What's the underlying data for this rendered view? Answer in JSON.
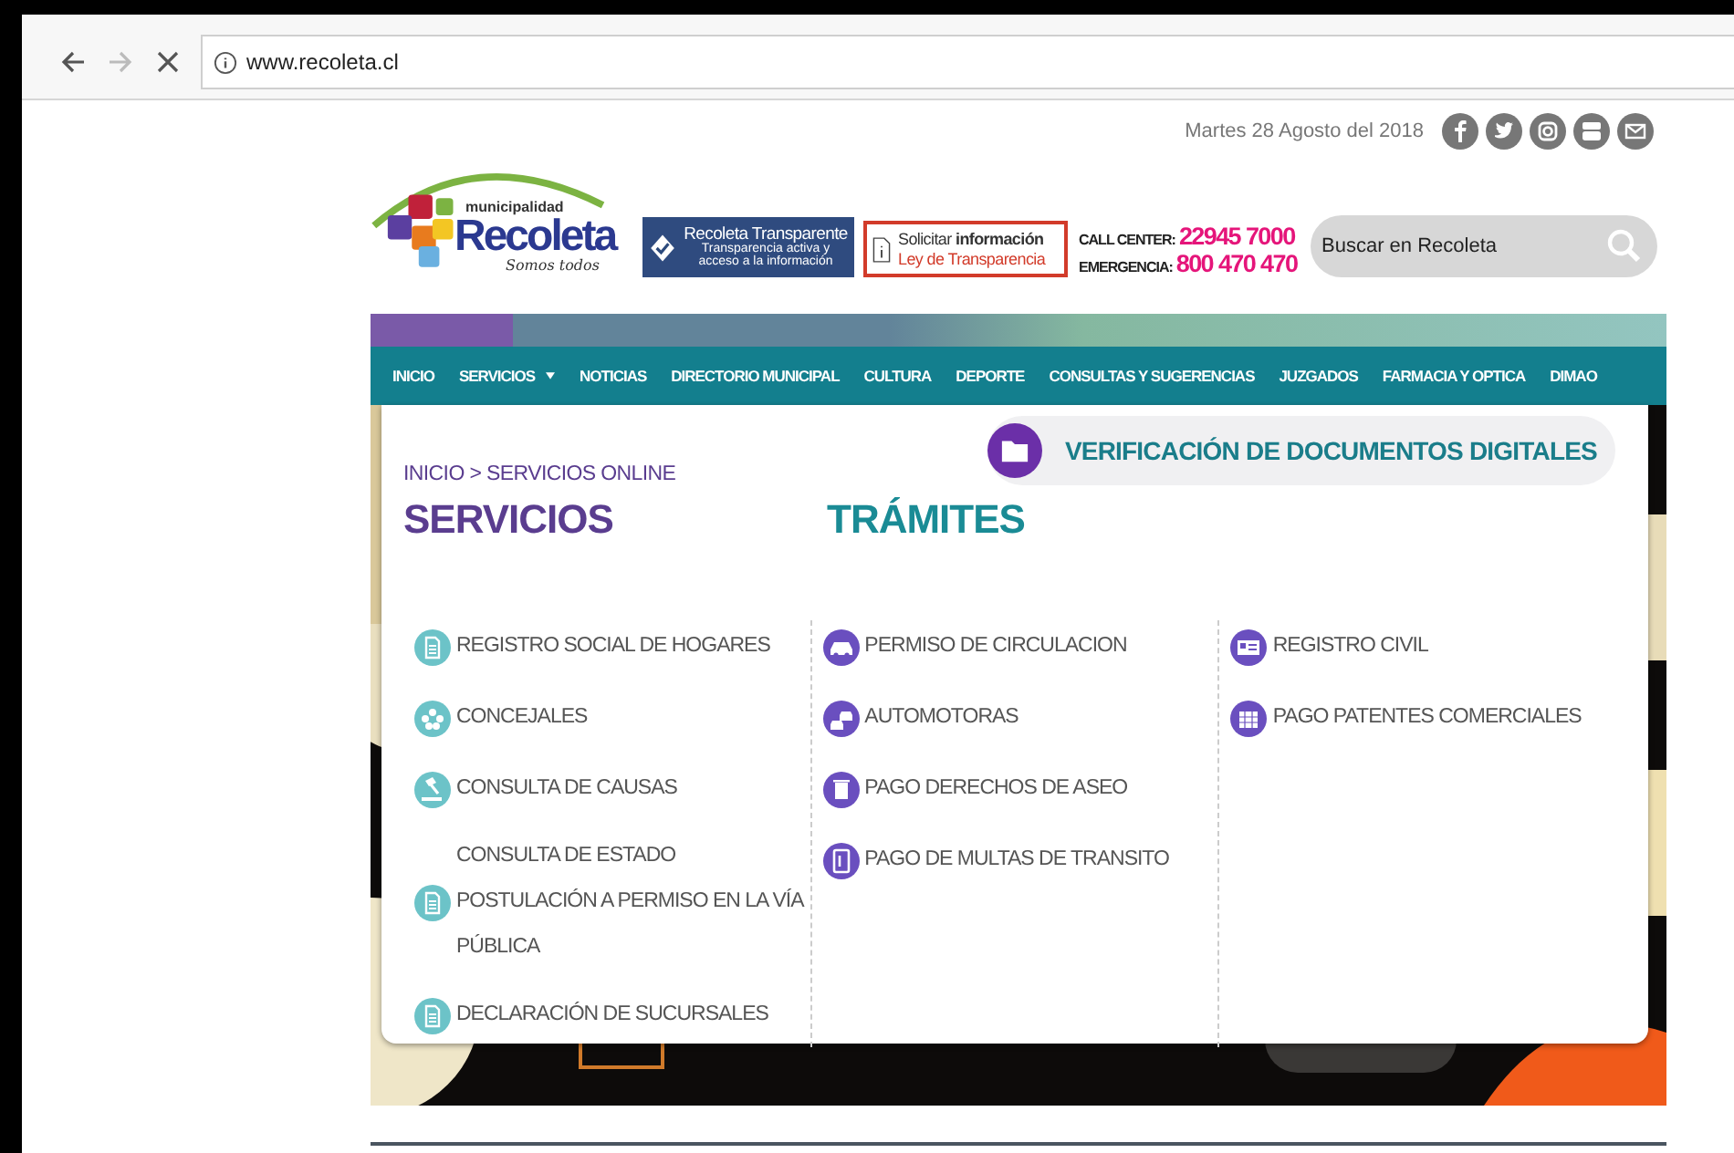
{
  "browser": {
    "url": "www.recoleta.cl"
  },
  "header": {
    "logo": {
      "top": "municipalidad",
      "name": "Recoleta",
      "tagline": "Somos todos"
    },
    "date": "Martes 28 Agosto del 2018",
    "transparency": {
      "title": "Recoleta Transparente",
      "subtitle": "Transparencia activa y acceso a la información"
    },
    "request": {
      "line1_plain": "Solicitar ",
      "line1_bold": "información",
      "line2": "Ley de Transparencia"
    },
    "phones": [
      {
        "label": "CALL CENTER:",
        "number": "22945 7000"
      },
      {
        "label": "EMERGENCIA:",
        "number": "800 470 470"
      }
    ],
    "search": {
      "placeholder": "Buscar en Recoleta"
    }
  },
  "nav": [
    {
      "label": "INICIO",
      "dropdown": false
    },
    {
      "label": "SERVICIOS",
      "dropdown": true
    },
    {
      "label": "NOTICIAS",
      "dropdown": false
    },
    {
      "label": "DIRECTORIO MUNICIPAL",
      "dropdown": false
    },
    {
      "label": "CULTURA",
      "dropdown": false
    },
    {
      "label": "DEPORTE",
      "dropdown": false
    },
    {
      "label": "CONSULTAS Y SUGERENCIAS",
      "dropdown": false
    },
    {
      "label": "JUZGADOS",
      "dropdown": false
    },
    {
      "label": "FARMACIA Y OPTICA",
      "dropdown": false
    },
    {
      "label": "DIMAO",
      "dropdown": false
    }
  ],
  "menu": {
    "breadcrumb": "INICIO > SERVICIOS ONLINE",
    "verify_button": "VERIFICACIÓN DE DOCUMENTOS DIGITALES",
    "headings": [
      "SERVICIOS",
      "TRÁMITES"
    ],
    "columns": [
      {
        "kind": "servicios",
        "items": [
          "REGISTRO SOCIAL DE HOGARES",
          "CONCEJALES",
          "CONSULTA DE CAUSAS",
          "CONSULTA DE ESTADO POSTULACIÓN A PERMISO EN LA VÍA PÚBLICA",
          "DECLARACIÓN DE SUCURSALES"
        ]
      },
      {
        "kind": "tramites",
        "items": [
          "PERMISO DE CIRCULACION",
          "AUTOMOTORAS",
          "PAGO DERECHOS DE ASEO",
          "PAGO DE MULTAS DE TRANSITO"
        ]
      },
      {
        "kind": "tramites",
        "items": [
          "REGISTRO CIVIL",
          "PAGO PATENTES COMERCIALES"
        ]
      }
    ]
  }
}
